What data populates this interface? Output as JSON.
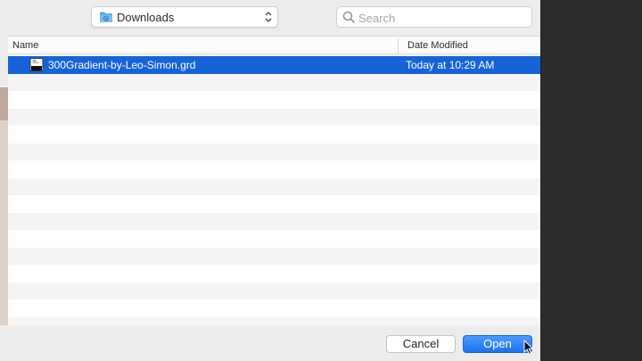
{
  "location": {
    "label": "Downloads",
    "icon": "folder-icon"
  },
  "search": {
    "placeholder": "Search",
    "value": ""
  },
  "columns": {
    "name": "Name",
    "date_modified": "Date Modified"
  },
  "files": [
    {
      "name": "300Gradient-by-Leo-Simon.grd",
      "date_modified": "Today at 10:29 AM",
      "selected": true
    }
  ],
  "buttons": {
    "cancel": "Cancel",
    "open": "Open"
  },
  "colors": {
    "selection": "#1663d9",
    "accent": "#1b72f0"
  }
}
